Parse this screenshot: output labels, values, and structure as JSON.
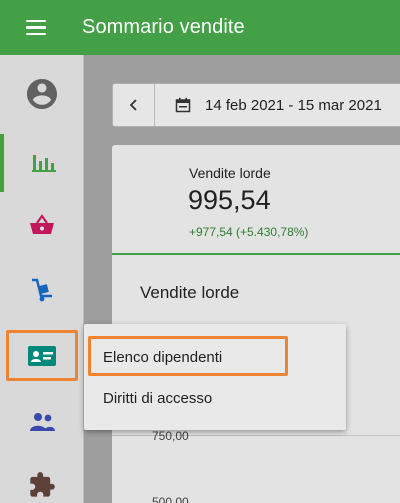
{
  "header": {
    "title": "Sommario vendite",
    "menu_icon": "hamburger-menu-icon"
  },
  "sidebar": {
    "items": [
      {
        "id": "profile",
        "icon": "account-circle-icon",
        "active": false
      },
      {
        "id": "sales",
        "icon": "bar-chart-icon",
        "active": true
      },
      {
        "id": "basket",
        "icon": "shopping-basket-icon",
        "active": false
      },
      {
        "id": "delivery",
        "icon": "hand-truck-icon",
        "active": false
      },
      {
        "id": "employees",
        "icon": "badge-icon",
        "active": false
      },
      {
        "id": "people",
        "icon": "people-icon",
        "active": false
      },
      {
        "id": "addons",
        "icon": "puzzle-icon",
        "active": false
      }
    ]
  },
  "date_range": {
    "label": "14 feb 2021 - 15 mar 2021"
  },
  "kpi": {
    "label": "Vendite lorde",
    "value": "995,54",
    "delta": "+977,54 (+5.430,78%)"
  },
  "chart": {
    "title": "Vendite lorde",
    "ticks": [
      "750,00",
      "500,00"
    ]
  },
  "popup_menu": {
    "items": [
      "Elenco dipendenti",
      "Diritti di accesso"
    ]
  },
  "colors": {
    "brand": "#43a047",
    "highlight": "#f0832f",
    "icon_gray": "#616161",
    "basket": "#c2185b",
    "truck": "#1565c0",
    "badge": "#00897b",
    "people": "#3949ab",
    "puzzle": "#5d4037"
  }
}
